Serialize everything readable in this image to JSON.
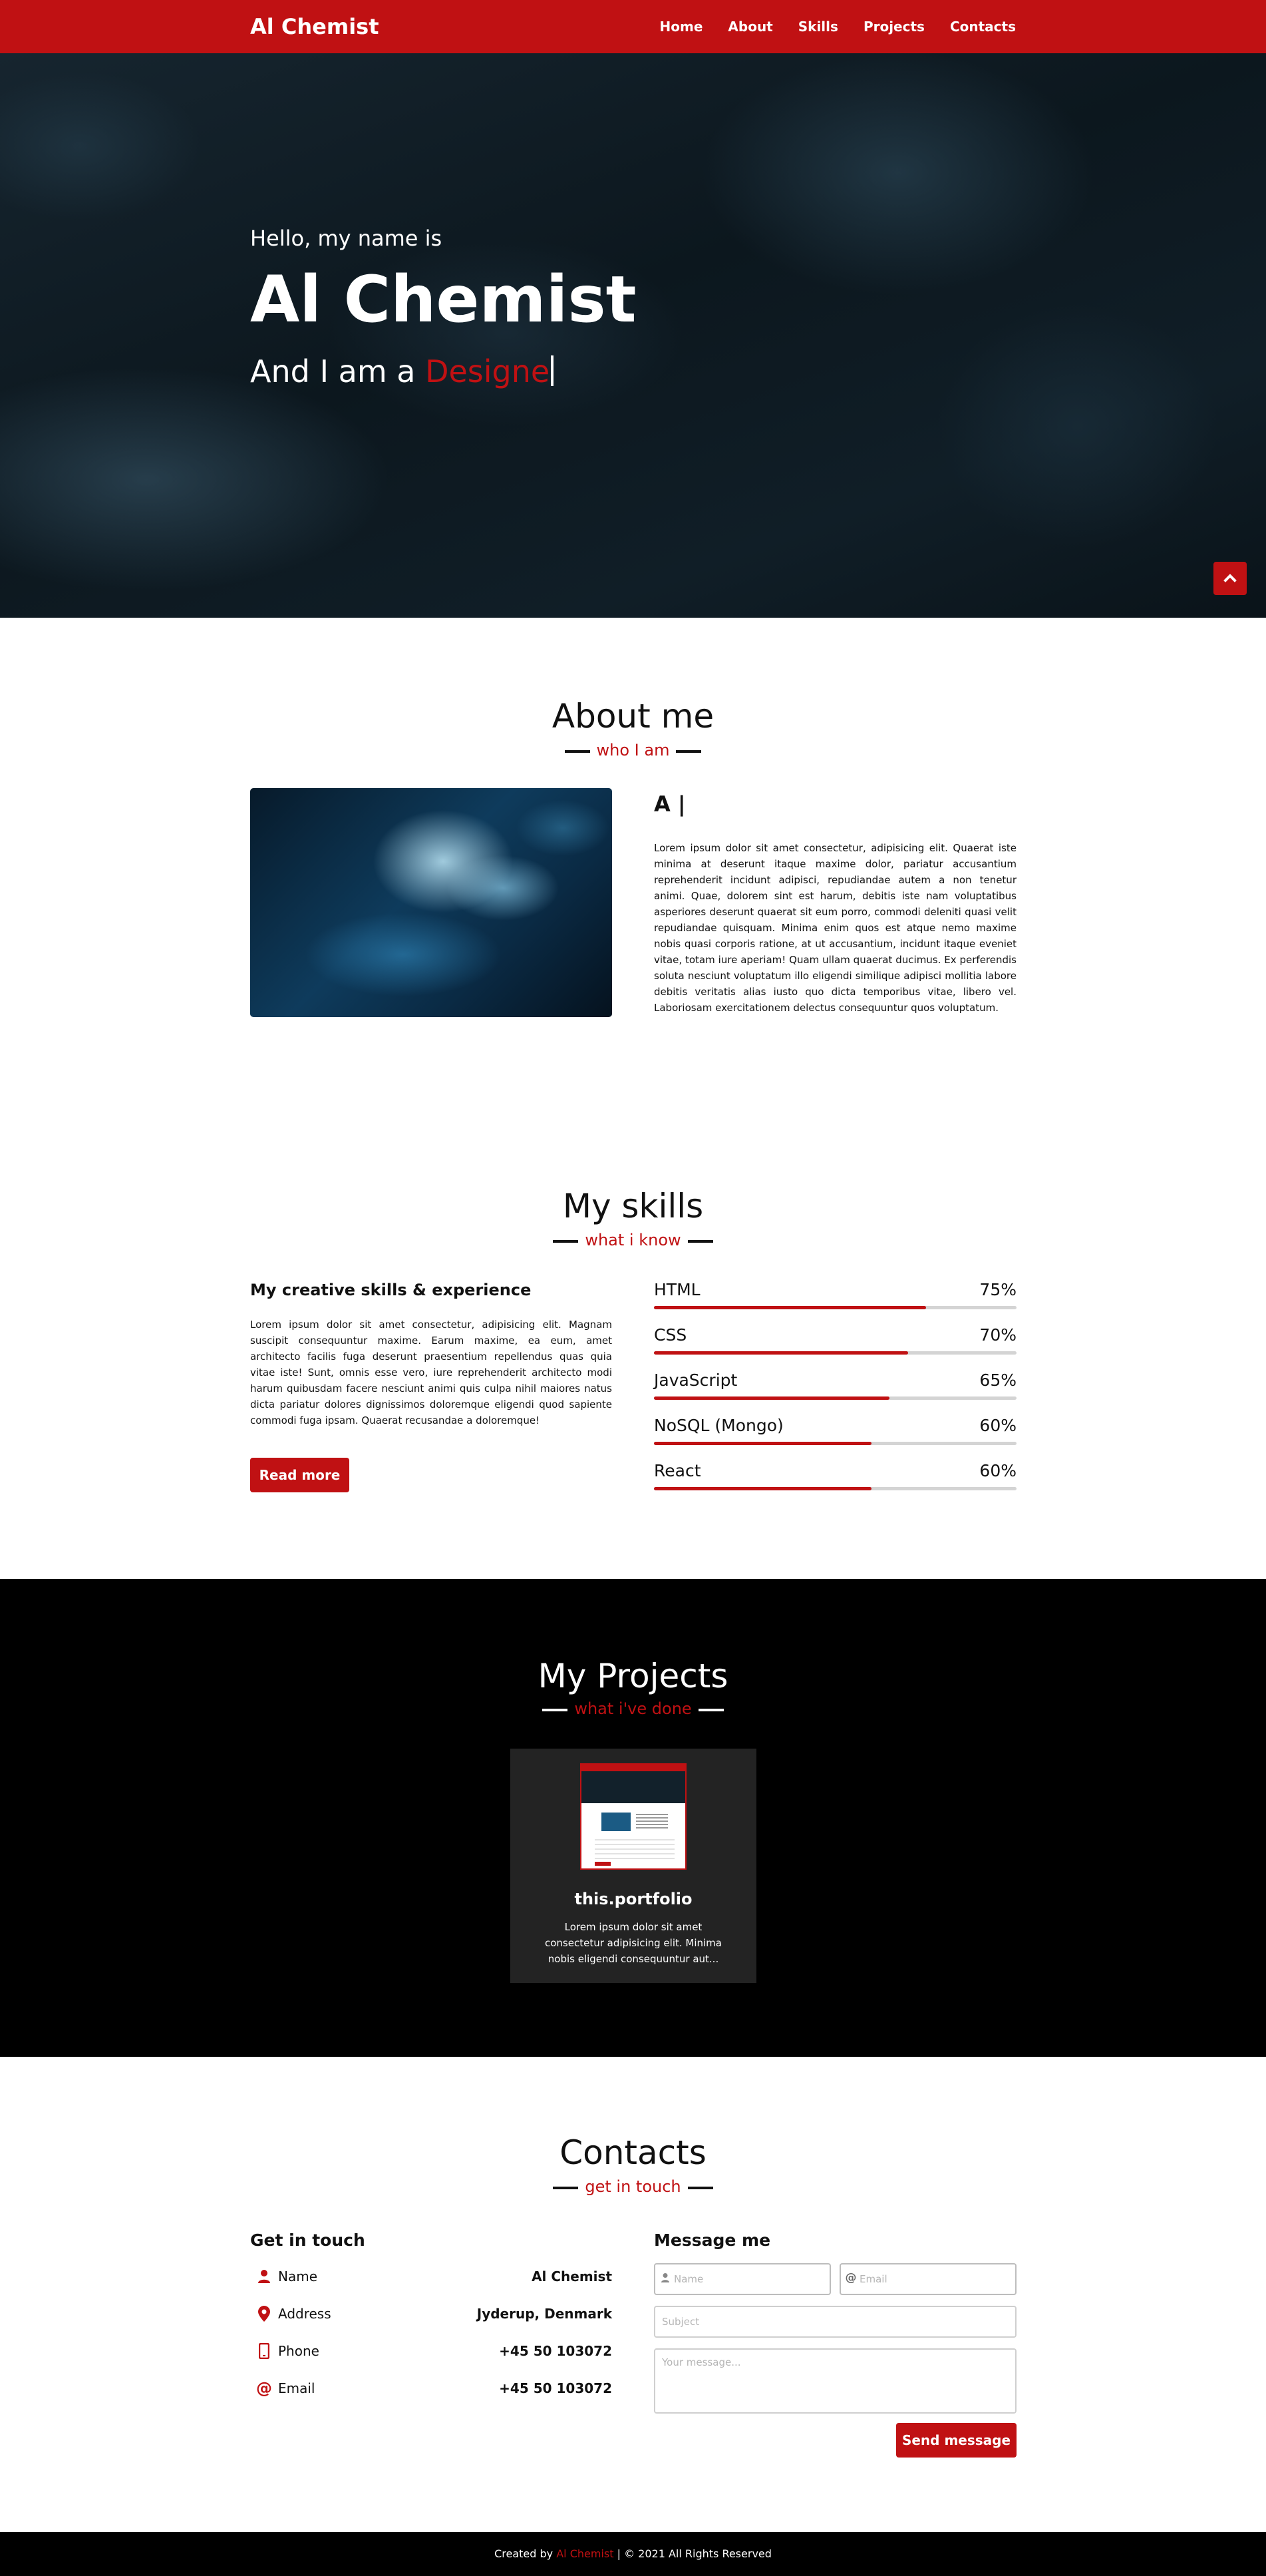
{
  "brand": "Al Chemist",
  "nav": [
    {
      "label": "Home"
    },
    {
      "label": "About"
    },
    {
      "label": "Skills"
    },
    {
      "label": "Projects"
    },
    {
      "label": "Contacts"
    }
  ],
  "hero": {
    "greeting": "Hello, my name is",
    "name": "Al Chemist",
    "role_prefix": "And I am a",
    "role_typed": "Designe"
  },
  "about": {
    "title": "About me",
    "subtitle": "who I am",
    "heading": "A |",
    "text": "Lorem ipsum dolor sit amet consectetur, adipisicing elit. Quaerat iste minima at deserunt itaque maxime dolor, pariatur accusantium reprehenderit incidunt adipisci, repudiandae autem a non tenetur animi. Quae, dolorem sint est harum, debitis iste nam voluptatibus asperiores deserunt quaerat sit eum porro, commodi deleniti quasi velit repudiandae quisquam. Minima enim quos est atque nemo maxime nobis quasi corporis ratione, at ut accusantium, incidunt itaque eveniet vitae, totam iure aperiam! Quam ullam quaerat ducimus. Ex perferendis soluta nesciunt voluptatum illo eligendi similique adipisci mollitia labore debitis veritatis alias iusto quo dicta temporibus vitae, libero vel. Laboriosam exercitationem delectus consequuntur quos voluptatum."
  },
  "skills": {
    "title": "My skills",
    "subtitle": "what i know",
    "heading": "My creative skills & experience",
    "text": "Lorem ipsum dolor sit amet consectetur, adipisicing elit. Magnam suscipit consequuntur maxime. Earum maxime, ea eum, amet architecto facilis fuga deserunt praesentium repellendus quas quia vitae iste! Sunt, omnis esse vero, iure reprehenderit architecto modi harum quibusdam facere nesciunt animi quis culpa nihil maiores natus dicta pariatur dolores dignissimos doloremque eligendi quod sapiente commodi fuga ipsam. Quaerat recusandae a doloremque!",
    "read_more": "Read more",
    "items": [
      {
        "name": "HTML",
        "percent_label": "75%",
        "percent": 75
      },
      {
        "name": "CSS",
        "percent_label": "70%",
        "percent": 70
      },
      {
        "name": "JavaScript",
        "percent_label": "65%",
        "percent": 65
      },
      {
        "name": "NoSQL (Mongo)",
        "percent_label": "60%",
        "percent": 60
      },
      {
        "name": "React",
        "percent_label": "60%",
        "percent": 60
      }
    ]
  },
  "projects": {
    "title": "My Projects",
    "subtitle": "what i've done",
    "items": [
      {
        "name": "this.portfolio",
        "description": "Lorem ipsum dolor sit amet consectetur adipisicing elit. Minima nobis eligendi consequuntur aut..."
      }
    ]
  },
  "contacts": {
    "title": "Contacts",
    "subtitle": "get in touch",
    "info_heading": "Get in touch",
    "info": [
      {
        "key": "Name",
        "value": "Al Chemist",
        "icon": "user-icon"
      },
      {
        "key": "Address",
        "value": "Jyderup, Denmark",
        "icon": "map-pin-icon"
      },
      {
        "key": "Phone",
        "value": "+45 50 103072",
        "icon": "phone-icon"
      },
      {
        "key": "Email",
        "value": "+45 50 103072",
        "icon": "at-icon"
      }
    ],
    "form_heading": "Message me",
    "form": {
      "name_placeholder": "Name",
      "email_placeholder": "Email",
      "subject_placeholder": "Subject",
      "message_placeholder": "Your message...",
      "send_label": "Send message"
    }
  },
  "footer": {
    "prefix": "Created by",
    "author": "Al Chemist",
    "suffix": "| © 2021 All Rights Reserved"
  },
  "colors": {
    "accent": "#c01113",
    "dark": "#000000",
    "card": "#232323"
  }
}
